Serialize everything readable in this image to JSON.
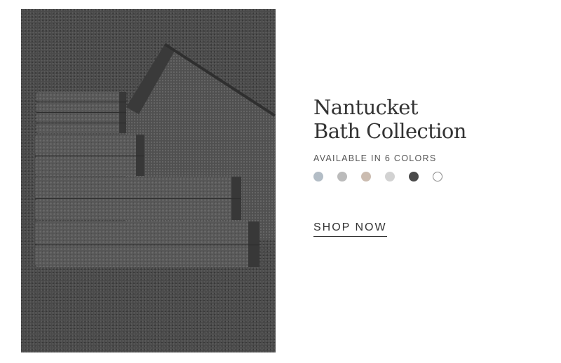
{
  "hero": {
    "alt": "Stack of charcoal textured bath towels"
  },
  "collection": {
    "title_line1": "Nantucket",
    "title_line2": "Bath Collection",
    "availability": "AVAILABLE IN 6 COLORS",
    "swatches": [
      {
        "name": "blue-gray",
        "color": "#b3bdc6"
      },
      {
        "name": "gray",
        "color": "#bbbbbb"
      },
      {
        "name": "taupe",
        "color": "#cbbcb0"
      },
      {
        "name": "light-gray",
        "color": "#d2d2d2"
      },
      {
        "name": "charcoal",
        "color": "#4a4a4a"
      },
      {
        "name": "white",
        "color": "#ffffff",
        "border": "#8a8a8a"
      }
    ]
  },
  "cta": {
    "label": "SHOP NOW"
  }
}
